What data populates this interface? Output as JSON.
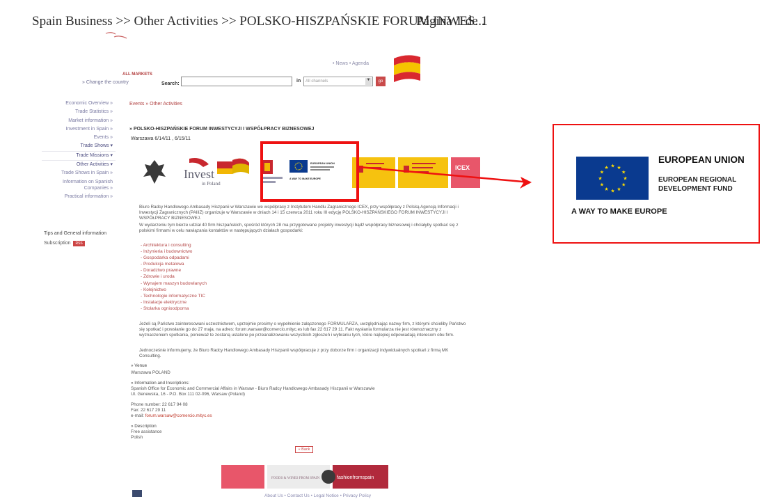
{
  "header": {
    "path": "Spain Business >> Other Activities >> POLSKO-HISZPAŃSKIE FORUM INWES...",
    "page_label": "Página 1 de 1"
  },
  "top_links": "• News   • Agenda",
  "change_country": "» Change the country",
  "all_markets": "ALL MARKETS",
  "search": {
    "label": "Search:",
    "in_label": "in",
    "channel": "All channels",
    "go": "go"
  },
  "nav": [
    "Economic Overview »",
    "Trade Statistics »",
    "Market information »",
    "Investment in Spain »",
    "Events »",
    "Trade Shows ▾",
    "Trade Missions ▾",
    "Other Activities ▾",
    "Trade Shows in Spain »",
    "Information on Spanish Companies »",
    "Practical information »"
  ],
  "tips": "Tips and General information",
  "subscription": {
    "label": "Subscription",
    "badge": "RSS"
  },
  "breadcrumb": "Events » Other Activities",
  "event_title": "» POLSKO-HISZPAŃSKIE FORUM INWESTYCYJI I WSPÓŁPRACY BIZNESOWEJ",
  "dates": "Warszawa  6/14/11  , 6/15/11",
  "logos": {
    "invest_text": "Invest",
    "invest_sub": "in Poland",
    "icex": "ICEX",
    "eu_small_title": "EUROPEAN UNION",
    "eu_small_motto": "A WAY TO MAKE EUROPE"
  },
  "body": {
    "p1": "Biuro Radcy Handlowego Ambasady Hiszpanii w Warszawie we współpracy z Instytutem Handlu Zagranicznego ICEX, przy współpracy z Polską Agencją Informacji i Inwestycji Zagranicznych (PAIiIZ) organizuje w Warszawie w dniach 14 i 15 czerwca 2011 roku III edycję POLSKO-HISZPAŃSKIEGO FORUM INWESTYCYJI I WSPÓŁPRACY BIZNESOWEJ.",
    "p2": "W wydarzeniu tym bierze udział 40 firm hiszpańskich, spośród których 28 ma przygotowane projekty inwestycji bądź współpracy biznesowej i chciałyby spotkać się z polskimi firmami w celu nawiązania kontaktów w następujących działach gospodarki:",
    "sectors": [
      "- Architektura i consulting",
      "- Inżynieria i budownictwo",
      "- Gospodarka odpadami",
      "- Produkcja metalowa",
      "- Doradztwo prawne",
      "- Zdrowie i uroda",
      "- Wynajem maszyn budowlanych",
      "- Kolejnictwo",
      "- Technologie informatyczne TIC",
      "- Instalacje elektryczne",
      "- Stolarka ognioodporna"
    ],
    "p3": "Jeżeli są Państwo zainteresowani uczestnictwem, uprzejmie prosimy o wypełnienie załączonego FORMULARZA, uwzględniając nazwy firm, z którymi chcieliby Państwo się spotkać i przesłanie go do 27 maja, na adres: forum.warsaw@comercio.mityc.es lub fax 22 617 29 11. Fakt wysłania formularza nie jest równoznaczny z wyznaczeniem spotkania, ponieważ te zostaną ustalone po przeanalizowaniu wszystkich zgłoszeń i wybraniu tych, które najlepiej odpowiadają interesom obu firm.",
    "p4": "Jednocześnie informujemy, że Biuro Radcy Handlowego Ambasady Hiszpanii współpracuje z przy doborze firm i organizacji indywidualnych spotkań z firmą MK Consulting."
  },
  "venue": {
    "head": "» Venue",
    "text": "Warszawa  POLAND"
  },
  "info": {
    "head": "» Information and Inscriptions:",
    "line1": "Spanish Office for Economic and Commercial Affairs in Warsaw - Biuro Radcy Handlowego Ambasady Hiszpanii w Warszawie",
    "line2": "Ul. Genewska, 16 - P.O. Box 111 02-096, Warsaw (Poland)",
    "phone": "Phone number: 22 617 94 08",
    "fax": "Fax: 22 617 29 11",
    "email_label": "e-mail:",
    "email": "forum.warsaw@comercio.mityc.es"
  },
  "description": {
    "head": "» Description",
    "line1": "Free assistance",
    "line2": "Polish"
  },
  "back": "« Back",
  "footer": {
    "banner_food": "FOODS & WINES FROM SPAIN",
    "banner_fashion": "fashionfromspain",
    "links": "About Us  •  Contact Us  •  Legal Notice  •  Privacy Policy"
  },
  "zoom": {
    "title": "EUROPEAN UNION",
    "sub1": "EUROPEAN REGIONAL",
    "sub2": "DEVELOPMENT FUND",
    "motto": "A WAY TO MAKE EUROPE"
  },
  "colors": {
    "highlight": "#e11111",
    "eu_blue": "#0a3a8f",
    "eu_gold": "#ffdd00",
    "link_red": "#b54848"
  }
}
